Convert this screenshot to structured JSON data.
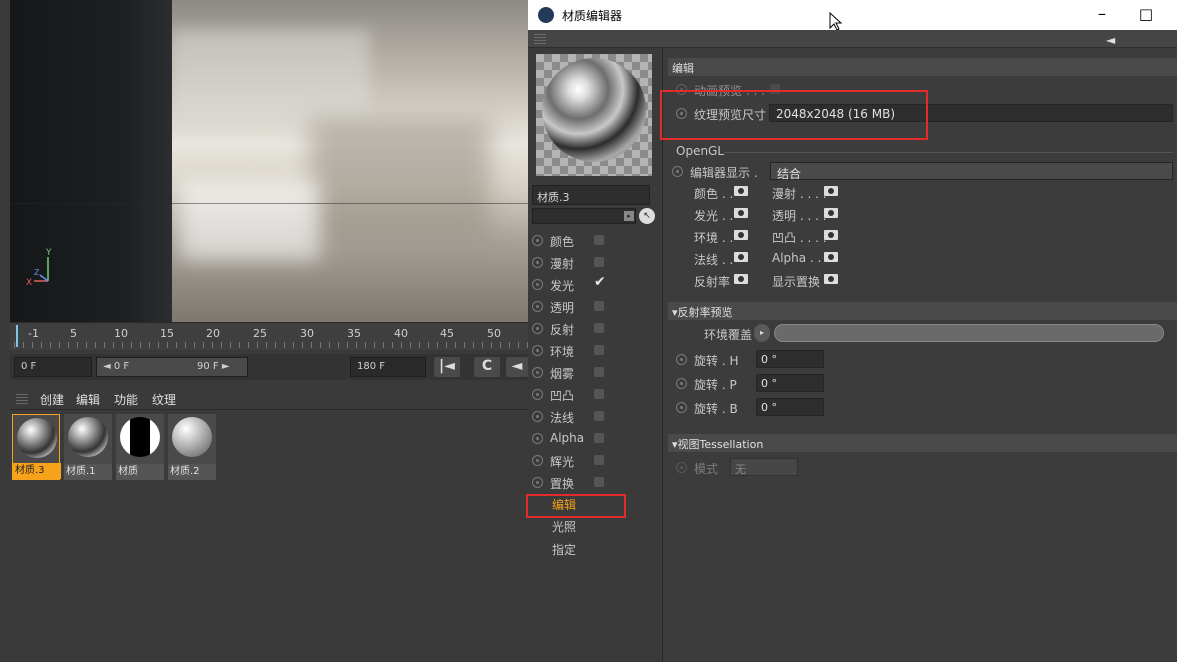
{
  "timeline": {
    "ticks": [
      "-1",
      "5",
      "10",
      "15",
      "20",
      "25",
      "30",
      "35",
      "40",
      "45",
      "50"
    ]
  },
  "frames": {
    "start": "0 F",
    "range_start": "◄ 0 F",
    "range_end": "90 F ►",
    "end": "180 F"
  },
  "mat_menu": {
    "create": "创建",
    "edit": "编辑",
    "function": "功能",
    "texture": "纹理"
  },
  "materials": [
    "材质.3",
    "材质.1",
    "材质",
    "材质.2"
  ],
  "editor": {
    "title": "材质编辑器",
    "material_name": "材质.3",
    "channels": [
      {
        "name": "颜色",
        "checked": false
      },
      {
        "name": "漫射",
        "checked": false
      },
      {
        "name": "发光",
        "checked": true
      },
      {
        "name": "透明",
        "checked": false
      },
      {
        "name": "反射",
        "checked": false
      },
      {
        "name": "环境",
        "checked": false
      },
      {
        "name": "烟雾",
        "checked": false
      },
      {
        "name": "凹凸",
        "checked": false
      },
      {
        "name": "法线",
        "checked": false
      },
      {
        "name": "Alpha",
        "checked": false
      },
      {
        "name": "辉光",
        "checked": false
      },
      {
        "name": "置换",
        "checked": false
      }
    ],
    "pages": [
      "编辑",
      "光照",
      "指定"
    ],
    "section_edit": "编辑",
    "anim_preview": "动画预览 . . .",
    "tex_preview_label": "纹理预览尺寸",
    "tex_preview_value": "2048x2048 (16 MB)",
    "opengl": "OpenGL",
    "editor_display_label": "编辑器显示 .",
    "editor_display_value": "结合",
    "eyes": [
      [
        "颜色 . .",
        "漫射 . . . ."
      ],
      [
        "发光 . .",
        "透明 . . . ."
      ],
      [
        "环境 . .",
        "凹凸 . . . ."
      ],
      [
        "法线 . .",
        "Alpha . ."
      ],
      [
        "反射率",
        "显示置换"
      ]
    ],
    "refl_preview": "▾反射率预览",
    "env_overlay": "环境覆盖",
    "rot_h": "旋转 . H",
    "rot_p": "旋转 . P",
    "rot_b": "旋转 . B",
    "rot_h_val": "0 °",
    "rot_p_val": "0 °",
    "rot_b_val": "0 °",
    "tess": "▾视图Tessellation",
    "mode_label": "模式",
    "mode_value": "无"
  },
  "colors": {
    "accent": "#f6a21a",
    "highlight_box": "#e22b2b"
  }
}
